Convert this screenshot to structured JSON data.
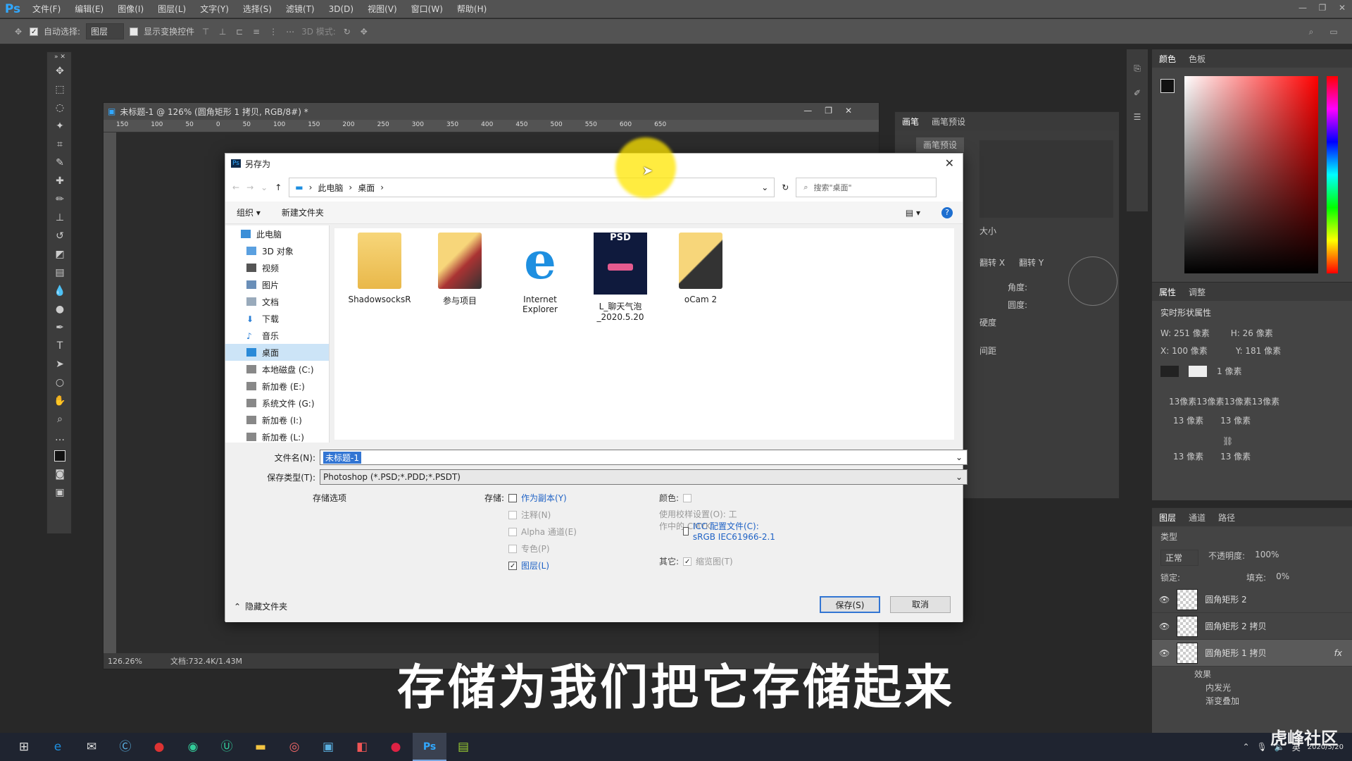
{
  "app": {
    "logo": "Ps",
    "menus": [
      "文件(F)",
      "编辑(E)",
      "图像(I)",
      "图层(L)",
      "文字(Y)",
      "选择(S)",
      "滤镜(T)",
      "3D(D)",
      "视图(V)",
      "窗口(W)",
      "帮助(H)"
    ]
  },
  "options": {
    "auto_select": "自动选择:",
    "auto_select_value": "图层",
    "show_transform": "显示变换控件",
    "mode_3d": "3D 模式:"
  },
  "document": {
    "title": "未标题-1 @ 126% (圆角矩形 1 拷贝, RGB/8#) *",
    "zoom": "126.26%",
    "doc_info": "文档:732.4K/1.43M",
    "ruler_ticks": [
      "150",
      "100",
      "50",
      "0",
      "50",
      "100",
      "150",
      "200",
      "250",
      "300",
      "350",
      "400",
      "450",
      "500",
      "550",
      "600",
      "650"
    ]
  },
  "brush": {
    "tabs": [
      "画笔",
      "画笔预设"
    ],
    "preset_btn": "画笔预设",
    "size": "大小",
    "flip_x": "翻转 X",
    "flip_y": "翻转 Y",
    "angle": "角度:",
    "roundness": "圆度:",
    "hardness": "硬度",
    "spacing": "间距"
  },
  "color": {
    "tabs": [
      "颜色",
      "色板"
    ]
  },
  "props": {
    "tabs": [
      "属性",
      "调整"
    ],
    "subtitle": "实时形状属性",
    "w": "W: 251 像素",
    "h": "H: 26 像素",
    "x": "X: 100 像素",
    "y": "Y: 181 像素",
    "stroke": "1 像素",
    "corners": "13像素13像素13像素13像素",
    "c1": "13 像素",
    "c2": "13 像素",
    "c3": "13 像素",
    "c4": "13 像素"
  },
  "layers": {
    "tabs": [
      "图层",
      "通道",
      "路径"
    ],
    "kind": "类型",
    "blend": "正常",
    "opacity_label": "不透明度:",
    "opacity": "100%",
    "lock_label": "锁定:",
    "fill_label": "填充:",
    "fill": "0%",
    "items": [
      {
        "name": "圆角矩形 2"
      },
      {
        "name": "圆角矩形 2 拷贝"
      },
      {
        "name": "圆角矩形 1 拷贝"
      }
    ],
    "effects_label": "效果",
    "effect1": "内发光",
    "effect2": "渐变叠加"
  },
  "dialog": {
    "icon": "Ps",
    "title": "另存为",
    "path": [
      "此电脑",
      "桌面"
    ],
    "search_placeholder": "搜索\"桌面\"",
    "organize": "组织 ▾",
    "new_folder": "新建文件夹",
    "nav": [
      {
        "label": "此电脑"
      },
      {
        "label": "3D 对象"
      },
      {
        "label": "视频"
      },
      {
        "label": "图片"
      },
      {
        "label": "文档"
      },
      {
        "label": "下载"
      },
      {
        "label": "音乐"
      },
      {
        "label": "桌面"
      },
      {
        "label": "本地磁盘 (C:)"
      },
      {
        "label": "新加卷 (E:)"
      },
      {
        "label": "系统文件 (G:)"
      },
      {
        "label": "新加卷 (I:)"
      },
      {
        "label": "新加卷 (L:)"
      }
    ],
    "files": [
      {
        "name": "ShadowsocksR"
      },
      {
        "name": "参与项目"
      },
      {
        "name": "Internet Explorer"
      },
      {
        "name": "L_聊天气泡_2020.5.20"
      },
      {
        "name": "oCam 2"
      }
    ],
    "psd_label": "PSD",
    "filename_label": "文件名(N):",
    "filename": "未标题-1",
    "filetype_label": "保存类型(T):",
    "filetype": "Photoshop (*.PSD;*.PDD;*.PSDT)",
    "save_options": "存储选项",
    "save_label": "存储:",
    "as_copy": "作为副本(Y)",
    "notes": "注释(N)",
    "alpha": "Alpha 通道(E)",
    "spot": "专色(P)",
    "layers": "图层(L)",
    "color_label": "颜色:",
    "proof": "使用校样设置(O): 工作中的 CMYK",
    "icc": "ICC 配置文件(C): sRGB IEC61966-2.1",
    "other_label": "其它:",
    "thumb": "缩览图(T)",
    "hide_folders": "隐藏文件夹",
    "save_btn": "保存(S)",
    "cancel_btn": "取消"
  },
  "subtitle": "存储为我们把它存储起来",
  "tray": {
    "lang": "英",
    "date": "2020/5/20"
  },
  "watermark": "虎峰社区"
}
